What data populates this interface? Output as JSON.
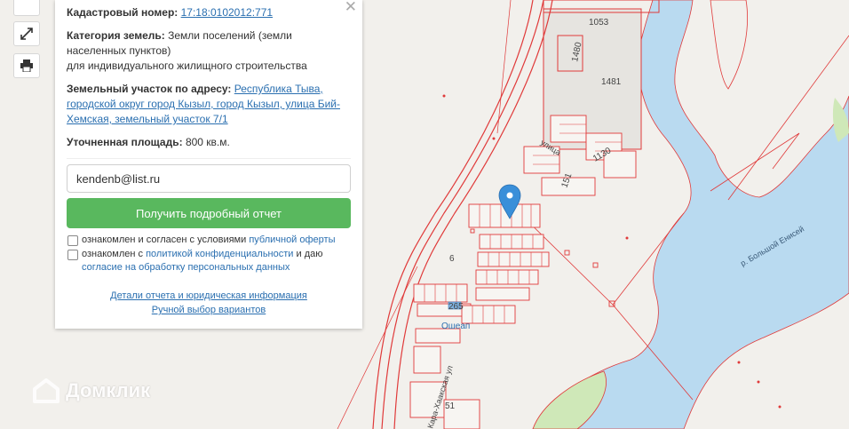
{
  "map": {
    "labels": {
      "parcel_1053": "1053",
      "parcel_1480": "1480",
      "parcel_1481": "1481",
      "parcel_1130": "1130",
      "parcel_151": "151",
      "parcel_6": "6",
      "parcel_265": "265",
      "parcel_51": "51",
      "street_1": "Ошеап",
      "street_2": "улица",
      "street_3": "Кара-Хаакская ул",
      "river": "р. Большой Енисей"
    }
  },
  "controls": {
    "expand_icon": "expand-arrows-icon",
    "print_icon": "printer-icon"
  },
  "info": {
    "cadastral_label": "Кадастровый номер:",
    "cadastral_number": "17:18:0102012:771",
    "category_label": "Категория земель:",
    "category_line1": "Земли поселений (земли",
    "category_line2": "населенных пунктов)",
    "category_line3": "для индивидуального жилищного строительства",
    "address_label": "Земельный участок по адресу:",
    "address_line1": "Республика Тыва,",
    "address_line2": "городской округ город Кызыл, город Кызыл, улица Бий-",
    "address_line3": "Хемская, земельный участок 7/1",
    "area_label": "Уточненная площадь:",
    "area_value": "800 кв.м."
  },
  "form": {
    "email_value": "kendenb@list.ru",
    "button_label": "Получить подробный отчет",
    "check1_text": "ознакомлен и согласен с условиями ",
    "check1_link": "публичной оферты",
    "check2_text": "ознакомлен с ",
    "check2_link": "политикой конфиденциальности",
    "check2_tail": " и даю",
    "check2_link2": "согласие на обработку персональных данных"
  },
  "footer": {
    "details_link": "Детали отчета и юридическая информация",
    "manual_link": "Ручной выбор вариантов"
  },
  "brand": {
    "logo_text": "Домклик"
  },
  "colors": {
    "button": "#59b85e",
    "link": "#2a6fb0",
    "parcel_line": "#e03a3a",
    "water": "#b9daf0",
    "marker": "#3a8fd9"
  }
}
